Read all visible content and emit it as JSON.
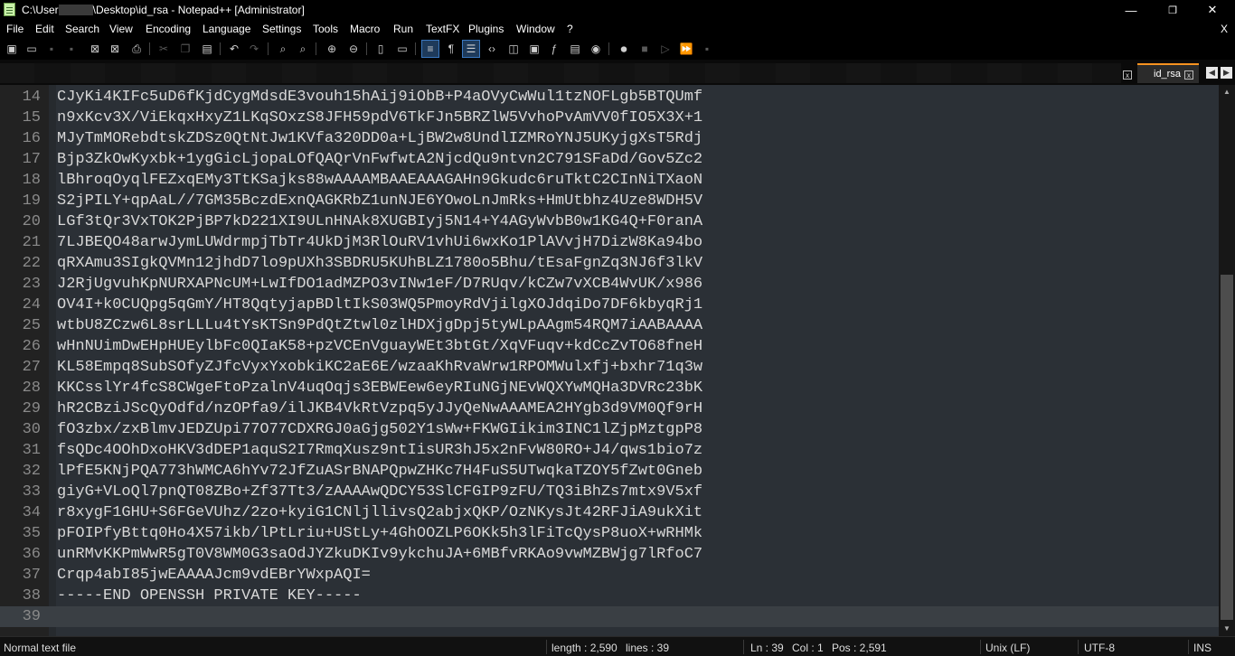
{
  "window": {
    "title_prefix": "C:\\User",
    "title_suffix": "\\Desktop\\id_rsa - Notepad++ [Administrator]",
    "minimize": "—",
    "maximize": "❐",
    "close": "✕"
  },
  "menu": {
    "items": [
      "File",
      "Edit",
      "Search",
      "View",
      "Encoding",
      "Language",
      "Settings",
      "Tools",
      "Macro",
      "Run",
      "TextFX",
      "Plugins",
      "Window",
      "?"
    ],
    "close": "X"
  },
  "tabs": {
    "active_label": "id_rsa",
    "close": "x",
    "left_arrow": "◀",
    "right_arrow": "▶"
  },
  "editor": {
    "lines": [
      {
        "n": "14",
        "text": "CJyKi4KIFc5uD6fKjdCygMdsdE3vouh15hAij9iObB+P4aOVyCwWul1tzNOFLgb5BTQUmf"
      },
      {
        "n": "15",
        "text": "n9xKcv3X/ViEkqxHxyZ1LKqSOxzS8JFH59pdV6TkFJn5BRZlW5VvhoPvAmVV0fIO5X3X+1"
      },
      {
        "n": "16",
        "text": "MJyTmMORebdtskZDSz0QtNtJw1KVfa320DD0a+LjBW2w8UndlIZMRoYNJ5UKyjgXsT5Rdj"
      },
      {
        "n": "17",
        "text": "Bjp3ZkOwKyxbk+1ygGicLjopaLOfQAQrVnFwfwtA2NjcdQu9ntvn2C791SFaDd/Gov5Zc2"
      },
      {
        "n": "18",
        "text": "lBhroqOyqlFEZxqEMy3TtKSajks88wAAAAMBAAEAAAGAHn9Gkudc6ruTktC2CInNiTXaoN"
      },
      {
        "n": "19",
        "text": "S2jPILY+qpAaL//7GM35BczdExnQAGKRbZ1unNJE6YOwoLnJmRks+HmUtbhz4Uze8WDH5V"
      },
      {
        "n": "20",
        "text": "LGf3tQr3VxTOK2PjBP7kD221XI9ULnHNAk8XUGBIyj5N14+Y4AGyWvbB0w1KG4Q+F0ranA"
      },
      {
        "n": "21",
        "text": "7LJBEQO48arwJymLUWdrmpjTbTr4UkDjM3RlOuRV1vhUi6wxKo1PlAVvjH7DizW8Ka94bo"
      },
      {
        "n": "22",
        "text": "qRXAmu3SIgkQVMn12jhdD7lo9pUXh3SBDRU5KUhBLZ1780o5Bhu/tEsaFgnZq3NJ6f3lkV"
      },
      {
        "n": "23",
        "text": "J2RjUgvuhKpNURXAPNcUM+LwIfDO1adMZPO3vINw1eF/D7RUqv/kCZw7vXCB4WvUK/x986"
      },
      {
        "n": "24",
        "text": "OV4I+k0CUQpg5qGmY/HT8QqtyjapBDltIkS03WQ5PmoyRdVjilgXOJdqiDo7DF6kbyqRj1"
      },
      {
        "n": "25",
        "text": "wtbU8ZCzw6L8srLLLu4tYsKTSn9PdQtZtwl0zlHDXjgDpj5tyWLpAAgm54RQM7iAABAAAA"
      },
      {
        "n": "26",
        "text": "wHnNUimDwEHpHUEylbFc0QIaK58+pzVCEnVguayWEt3btGt/XqVFuqv+kdCcZvTO68fneH"
      },
      {
        "n": "27",
        "text": "KL58Empq8SubSOfyZJfcVyxYxobkiKC2aE6E/wzaaKhRvaWrw1RPOMWulxfj+bxhr71q3w"
      },
      {
        "n": "28",
        "text": "KKCsslYr4fcS8CWgeFtoPzalnV4uqOqjs3EBWEew6eyRIuNGjNEvWQXYwMQHa3DVRc23bK"
      },
      {
        "n": "29",
        "text": "hR2CBziJScQyOdfd/nzOPfa9/ilJKB4VkRtVzpq5yJJyQeNwAAAMEA2HYgb3d9VM0Qf9rH"
      },
      {
        "n": "30",
        "text": "fO3zbx/zxBlmvJEDZUpi77O77CDXRGJ0aGjg502Y1sWw+FKWGIikim3INC1lZjpMztgpP8"
      },
      {
        "n": "31",
        "text": "fsQDc4OOhDxoHKV3dDEP1aquS2I7RmqXusz9ntIisUR3hJ5x2nFvW80RO+J4/qws1bio7z"
      },
      {
        "n": "32",
        "text": "lPfE5KNjPQA773hWMCA6hYv72JfZuASrBNAPQpwZHKc7H4FuS5UTwqkaTZOY5fZwt0Gneb"
      },
      {
        "n": "33",
        "text": "giyG+VLoQl7pnQT08ZBo+Zf37Tt3/zAAAAwQDCY53SlCFGIP9zFU/TQ3iBhZs7mtx9V5xf"
      },
      {
        "n": "34",
        "text": "r8xygF1GHU+S6FGeVUhz/2zo+kyiG1CNljllivsQ2abjxQKP/OzNKysJt42RFJiA9ukXit"
      },
      {
        "n": "35",
        "text": "pFOIPfyBttq0Ho4X57ikb/lPtLriu+UStLy+4GhOOZLP6OKk5h3lFiTcQysP8uoX+wRHMk"
      },
      {
        "n": "36",
        "text": "unRMvKKPmWwR5gT0V8WM0G3saOdJYZkuDKIv9ykchuJA+6MBfvRKAo9vwMZBWjg7lRfoC7"
      },
      {
        "n": "37",
        "text": "Crqp4abI85jwEAAAAJcm9vdEBrYWxpAQI="
      },
      {
        "n": "38",
        "text": "-----END OPENSSH PRIVATE KEY-----"
      },
      {
        "n": "39",
        "text": ""
      }
    ]
  },
  "status": {
    "file_type": "Normal text file",
    "length": "length : 2,590",
    "lines": "lines : 39",
    "ln": "Ln : 39",
    "col": "Col : 1",
    "pos": "Pos : 2,591",
    "eol": "Unix (LF)",
    "encoding": "UTF-8",
    "mode": "INS"
  },
  "icons": {
    "new": "new-file-icon",
    "open": "open-file-icon",
    "save": "save-icon",
    "save_all": "save-all-icon",
    "close": "close-file-icon",
    "close_all": "close-all-icon",
    "print": "print-icon",
    "cut": "cut-icon",
    "copy": "copy-icon",
    "paste": "paste-icon",
    "undo": "undo-icon",
    "redo": "redo-icon",
    "find": "find-icon",
    "replace": "replace-icon",
    "zoom_in": "zoom-in-icon",
    "zoom_out": "zoom-out-icon",
    "wrap": "word-wrap-icon",
    "all_chars": "show-all-chars-icon",
    "indent": "indent-guide-icon",
    "record": "record-macro-icon",
    "stop": "stop-record-icon",
    "play": "play-macro-icon"
  }
}
